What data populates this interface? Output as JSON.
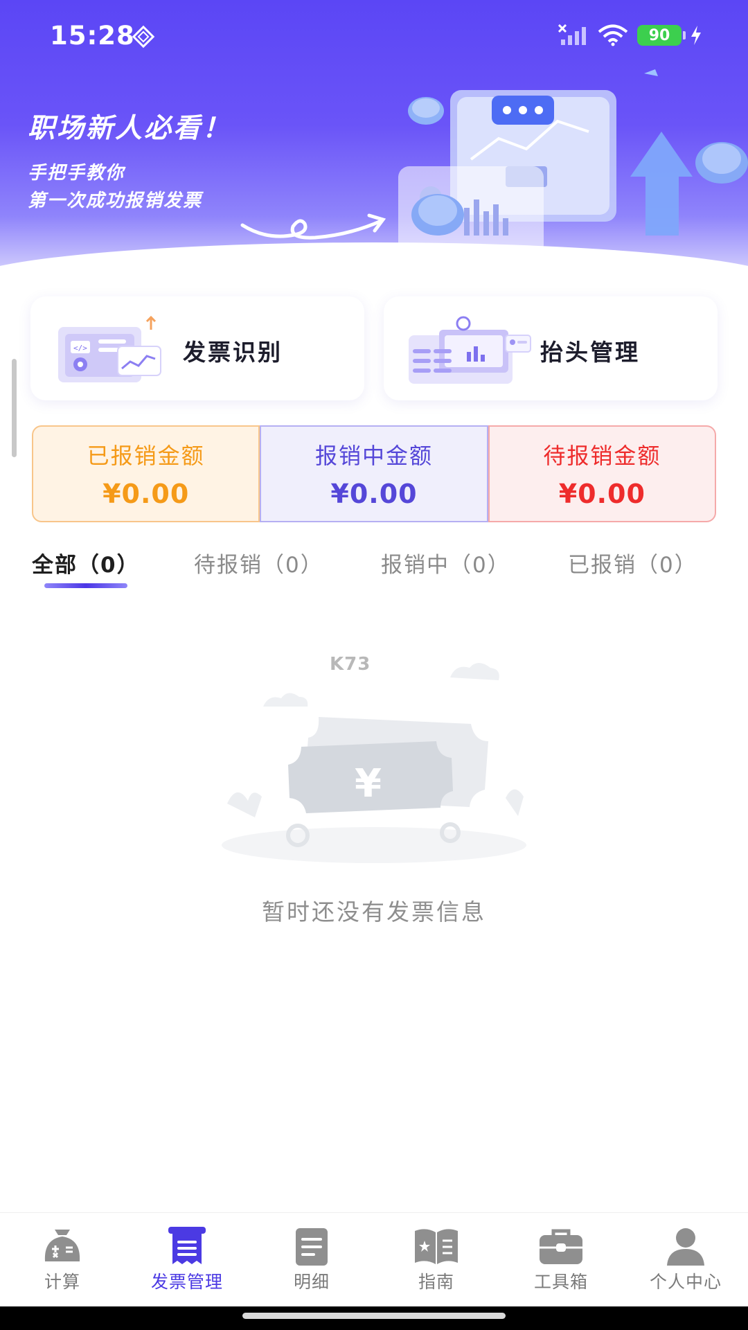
{
  "status_bar": {
    "time": "15:28",
    "battery": "90"
  },
  "banner": {
    "title": "职场新人必看！",
    "subtitle_line1": "手把手教你",
    "subtitle_line2": "第一次成功报销发票"
  },
  "features": {
    "invoice_recognition": "发票识别",
    "title_management": "抬头管理"
  },
  "summary": {
    "reimbursed_label": "已报销金额",
    "reimbursed_value": "¥0.00",
    "in_progress_label": "报销中金额",
    "in_progress_value": "¥0.00",
    "pending_label": "待报销金额",
    "pending_value": "¥0.00"
  },
  "tabs": [
    {
      "label": "全部（0）",
      "active": true
    },
    {
      "label": "待报销（0）",
      "active": false
    },
    {
      "label": "报销中（0）",
      "active": false
    },
    {
      "label": "已报销（0）",
      "active": false
    }
  ],
  "empty_state": {
    "watermark": "K73",
    "currency_symbol": "¥",
    "message": "暂时还没有发票信息"
  },
  "bottom_nav": [
    {
      "label": "计算",
      "icon": "calculator-bag-icon",
      "active": false
    },
    {
      "label": "发票管理",
      "icon": "invoice-icon",
      "active": true
    },
    {
      "label": "明细",
      "icon": "document-list-icon",
      "active": false
    },
    {
      "label": "指南",
      "icon": "guide-book-icon",
      "active": false
    },
    {
      "label": "工具箱",
      "icon": "toolbox-icon",
      "active": false
    },
    {
      "label": "个人中心",
      "icon": "person-icon",
      "active": false
    }
  ],
  "colors": {
    "brand": "#5b46f5",
    "nav_active": "#4b3ae3",
    "reimbursed": "#f59a18",
    "in_progress": "#5547d8",
    "pending": "#ee2c2c"
  }
}
